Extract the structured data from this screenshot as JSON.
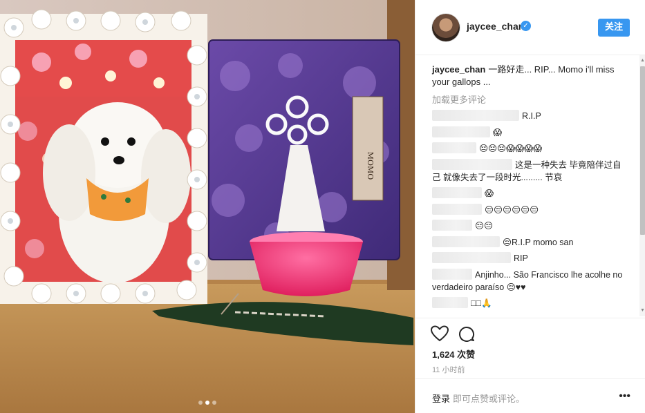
{
  "post": {
    "username": "jaycee_chan",
    "verified_icon": "verified-badge-icon",
    "follow_label": "关注",
    "caption_username": "jaycee_chan",
    "caption_text": "一路好走... RIP... Momo i'll miss your gallops ...",
    "load_more_label": "加载更多评论",
    "photo_frame_label": "MOMO",
    "carousel": {
      "count": 3,
      "active_index": 1
    }
  },
  "comments": [
    {
      "text": "R.I.P"
    },
    {
      "text": "😱"
    },
    {
      "text": "😔😔😔😱😱😱😱"
    },
    {
      "text": "这是一种失去 毕竟陪伴过自己 就像失去了一段时光......... 节哀"
    },
    {
      "text": "😱"
    },
    {
      "text": "😔😔😔😔😔😔"
    },
    {
      "text": "😔😔"
    },
    {
      "text": "😔R.I.P momo san"
    },
    {
      "text": "RIP"
    },
    {
      "text": "Anjinho... São Francisco lhe acolhe no verdadeiro paraíso 😔♥♥"
    },
    {
      "text": "□□🙏"
    }
  ],
  "actions": {
    "like_icon": "heart-icon",
    "comment_icon": "comment-bubble-icon",
    "views": "1,624 次赞",
    "time": "11 小时前"
  },
  "footer": {
    "login_label": "登录",
    "login_rest": "即可点赞或评论。",
    "more_icon": "more-options-icon",
    "more_symbol": "•••"
  },
  "colors": {
    "accent": "#3897f0",
    "text": "#262626",
    "muted": "#999999",
    "border": "#efefef"
  }
}
